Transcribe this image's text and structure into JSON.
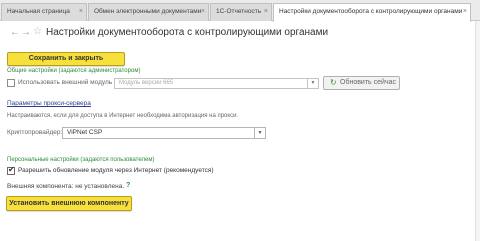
{
  "tabs": [
    {
      "label": "Начальная страница",
      "close": "×",
      "active": false
    },
    {
      "label": "Обмен электронными документами",
      "close": "×",
      "active": false
    },
    {
      "label": "1С-Отчетность",
      "close": "×",
      "active": false
    },
    {
      "label": "Настройки документооборота с контролирующими органами",
      "close": "×",
      "active": true
    }
  ],
  "header": {
    "back_glyph": "←",
    "forward_glyph": "→",
    "favorite_glyph": "☆",
    "title": "Настройки документооборота с контролирующими органами"
  },
  "toolbar": {
    "save_close_label": "Сохранить и закрыть"
  },
  "general": {
    "section_title": "Общие настройки (задаются администратором)",
    "use_external_module_label": "Использовать внешний модуль",
    "use_external_module_checked": false,
    "module_version_value": "Модуль версии 665",
    "dropdown_glyph": "▼",
    "refresh_label": "Обновить сейчас",
    "refresh_glyph": "↻"
  },
  "proxy": {
    "link_text": "Параметры прокси-сервера",
    "hint": "Настраиваются, если для доступа в Интернет необходима авторизация на прокси."
  },
  "crypto": {
    "label": "Криптопровайдер:",
    "value": "ViPNet CSP",
    "dropdown_glyph": "▼"
  },
  "personal": {
    "section_title": "Персональные настройки (задаются пользователем)",
    "allow_update_label": "Разрешить обновление модуля через Интернет (рекомендуется)",
    "allow_update_checked": true,
    "check_glyph": "✔"
  },
  "external_component": {
    "status": "Внешняя компонента: не установлена.",
    "help_glyph": "?",
    "install_label": "Установить внешнюю компоненту"
  },
  "colors": {
    "accent_yellow": "#f7e03b",
    "section_green": "#2e8b3a",
    "link_blue": "#2c3d8f"
  }
}
